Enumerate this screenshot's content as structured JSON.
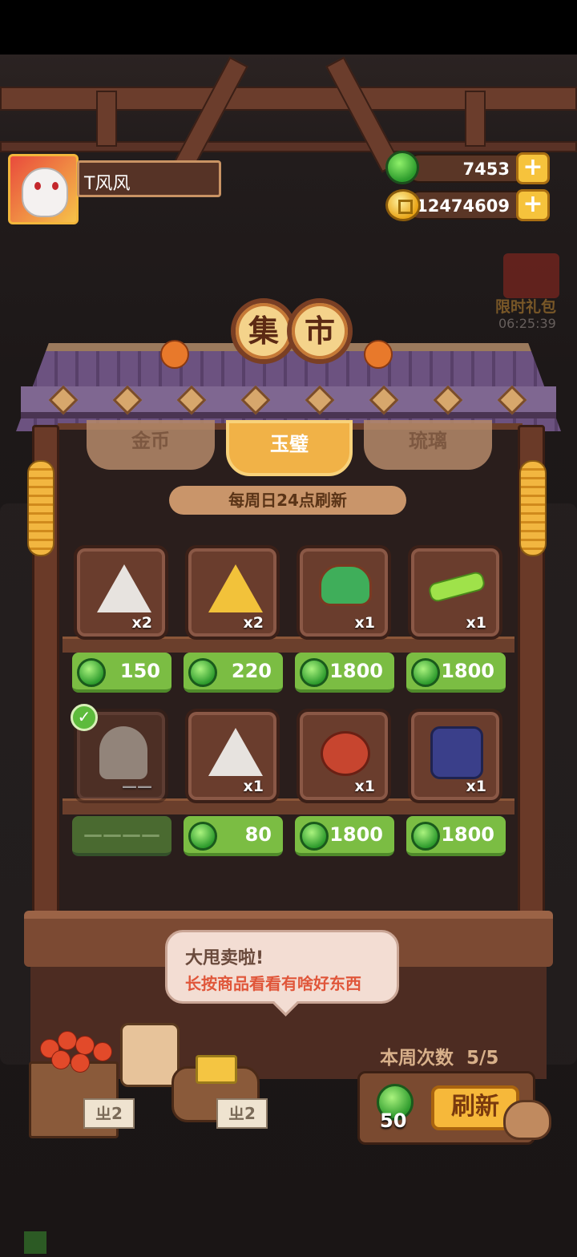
{
  "player": {
    "name": "T风风"
  },
  "currency": {
    "jade": "7453",
    "coins": "12474609",
    "plus": "+"
  },
  "gift": {
    "label": "限时礼包",
    "timer": "06:25:39"
  },
  "market": {
    "sign_left": "集",
    "sign_right": "市"
  },
  "tabs": [
    {
      "label": "金币",
      "active": false
    },
    {
      "label": "玉璧",
      "active": true
    },
    {
      "label": "琉璃",
      "active": false
    }
  ],
  "refresh_note": "每周日24点刷新",
  "items": [
    {
      "name": "white-talisman",
      "count": "x2",
      "price": "150",
      "sold": false
    },
    {
      "name": "gold-talisman",
      "count": "x2",
      "price": "220",
      "sold": false
    },
    {
      "name": "jade-cauldron",
      "count": "x1",
      "price": "1800",
      "sold": false
    },
    {
      "name": "jade-scroll",
      "count": "x1",
      "price": "1800",
      "sold": false
    },
    {
      "name": "character-card",
      "count": "——",
      "price": "————",
      "sold": true
    },
    {
      "name": "white-talisman-2",
      "count": "x1",
      "price": "80",
      "sold": false
    },
    {
      "name": "flower-bird-vase",
      "count": "x1",
      "price": "1800",
      "sold": false
    },
    {
      "name": "blue-cake",
      "count": "x1",
      "price": "1800",
      "sold": false
    }
  ],
  "speech": {
    "title": "大甩卖啦!",
    "subtitle": "长按商品看看有啥好东西"
  },
  "weekly": {
    "label": "本周次数",
    "value": "5/5"
  },
  "refresh": {
    "cost": "50",
    "button": "刷新"
  },
  "tags": {
    "left": "ㄓ2",
    "right": "ㄓ2"
  }
}
